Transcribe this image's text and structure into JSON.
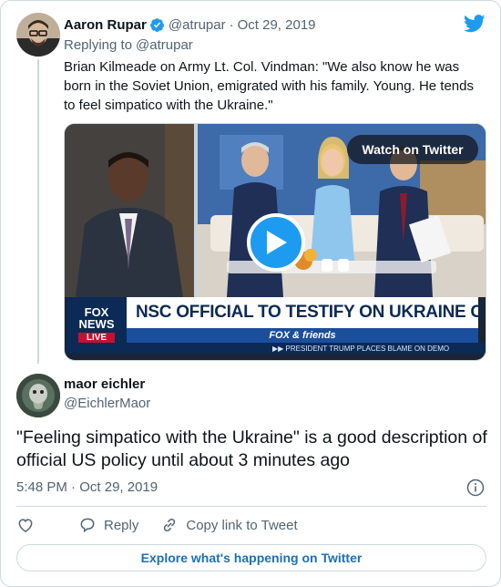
{
  "colors": {
    "twitter_blue": "#1d9bf0",
    "text_primary": "#0f1419",
    "text_secondary": "#536471",
    "border": "#cfd9de",
    "fox_navy": "#0b2a55",
    "fox_red": "#c8102e"
  },
  "parent_tweet": {
    "author_name": "Aaron Rupar",
    "handle": "@atrupar",
    "separator": "·",
    "date": "Oct 29, 2019",
    "reply_prefix": "Replying to",
    "reply_to": "@atrupar",
    "text": "Brian Kilmeade on Army Lt. Col. Vindman: \"We also know he was born in the Soviet Union, emigrated with his family. Young. He tends to feel simpatico with the Ukraine.\"",
    "icons": {
      "verified": "verified-badge-icon",
      "brand": "twitter-bird-icon"
    },
    "video": {
      "watch_label": "Watch on Twitter",
      "chyron_headline": "NSC OFFICIAL TO TESTIFY ON UKRAINE CALL",
      "chyron_show": "FOX & friends",
      "chyron_ticker": "▶▶  PRESIDENT TRUMP PLACES BLAME ON DEMO",
      "network_logo_line1": "FOX",
      "network_logo_line2": "NEWS",
      "network_logo_live": "LIVE"
    }
  },
  "quote_tweet": {
    "author_name": "maor eichler",
    "handle": "@EichlerMaor",
    "text": "\"Feeling simpatico with the Ukraine\" is a good description of official US policy until about 3 minutes ago",
    "time": "5:48 PM",
    "separator": "·",
    "date": "Oct 29, 2019"
  },
  "actions": {
    "reply_label": "Reply",
    "copy_link_label": "Copy link to Tweet",
    "icons": [
      "heart-icon",
      "reply-icon",
      "link-icon",
      "info-icon"
    ]
  },
  "explore_button": {
    "label": "Explore what's happening on Twitter"
  }
}
